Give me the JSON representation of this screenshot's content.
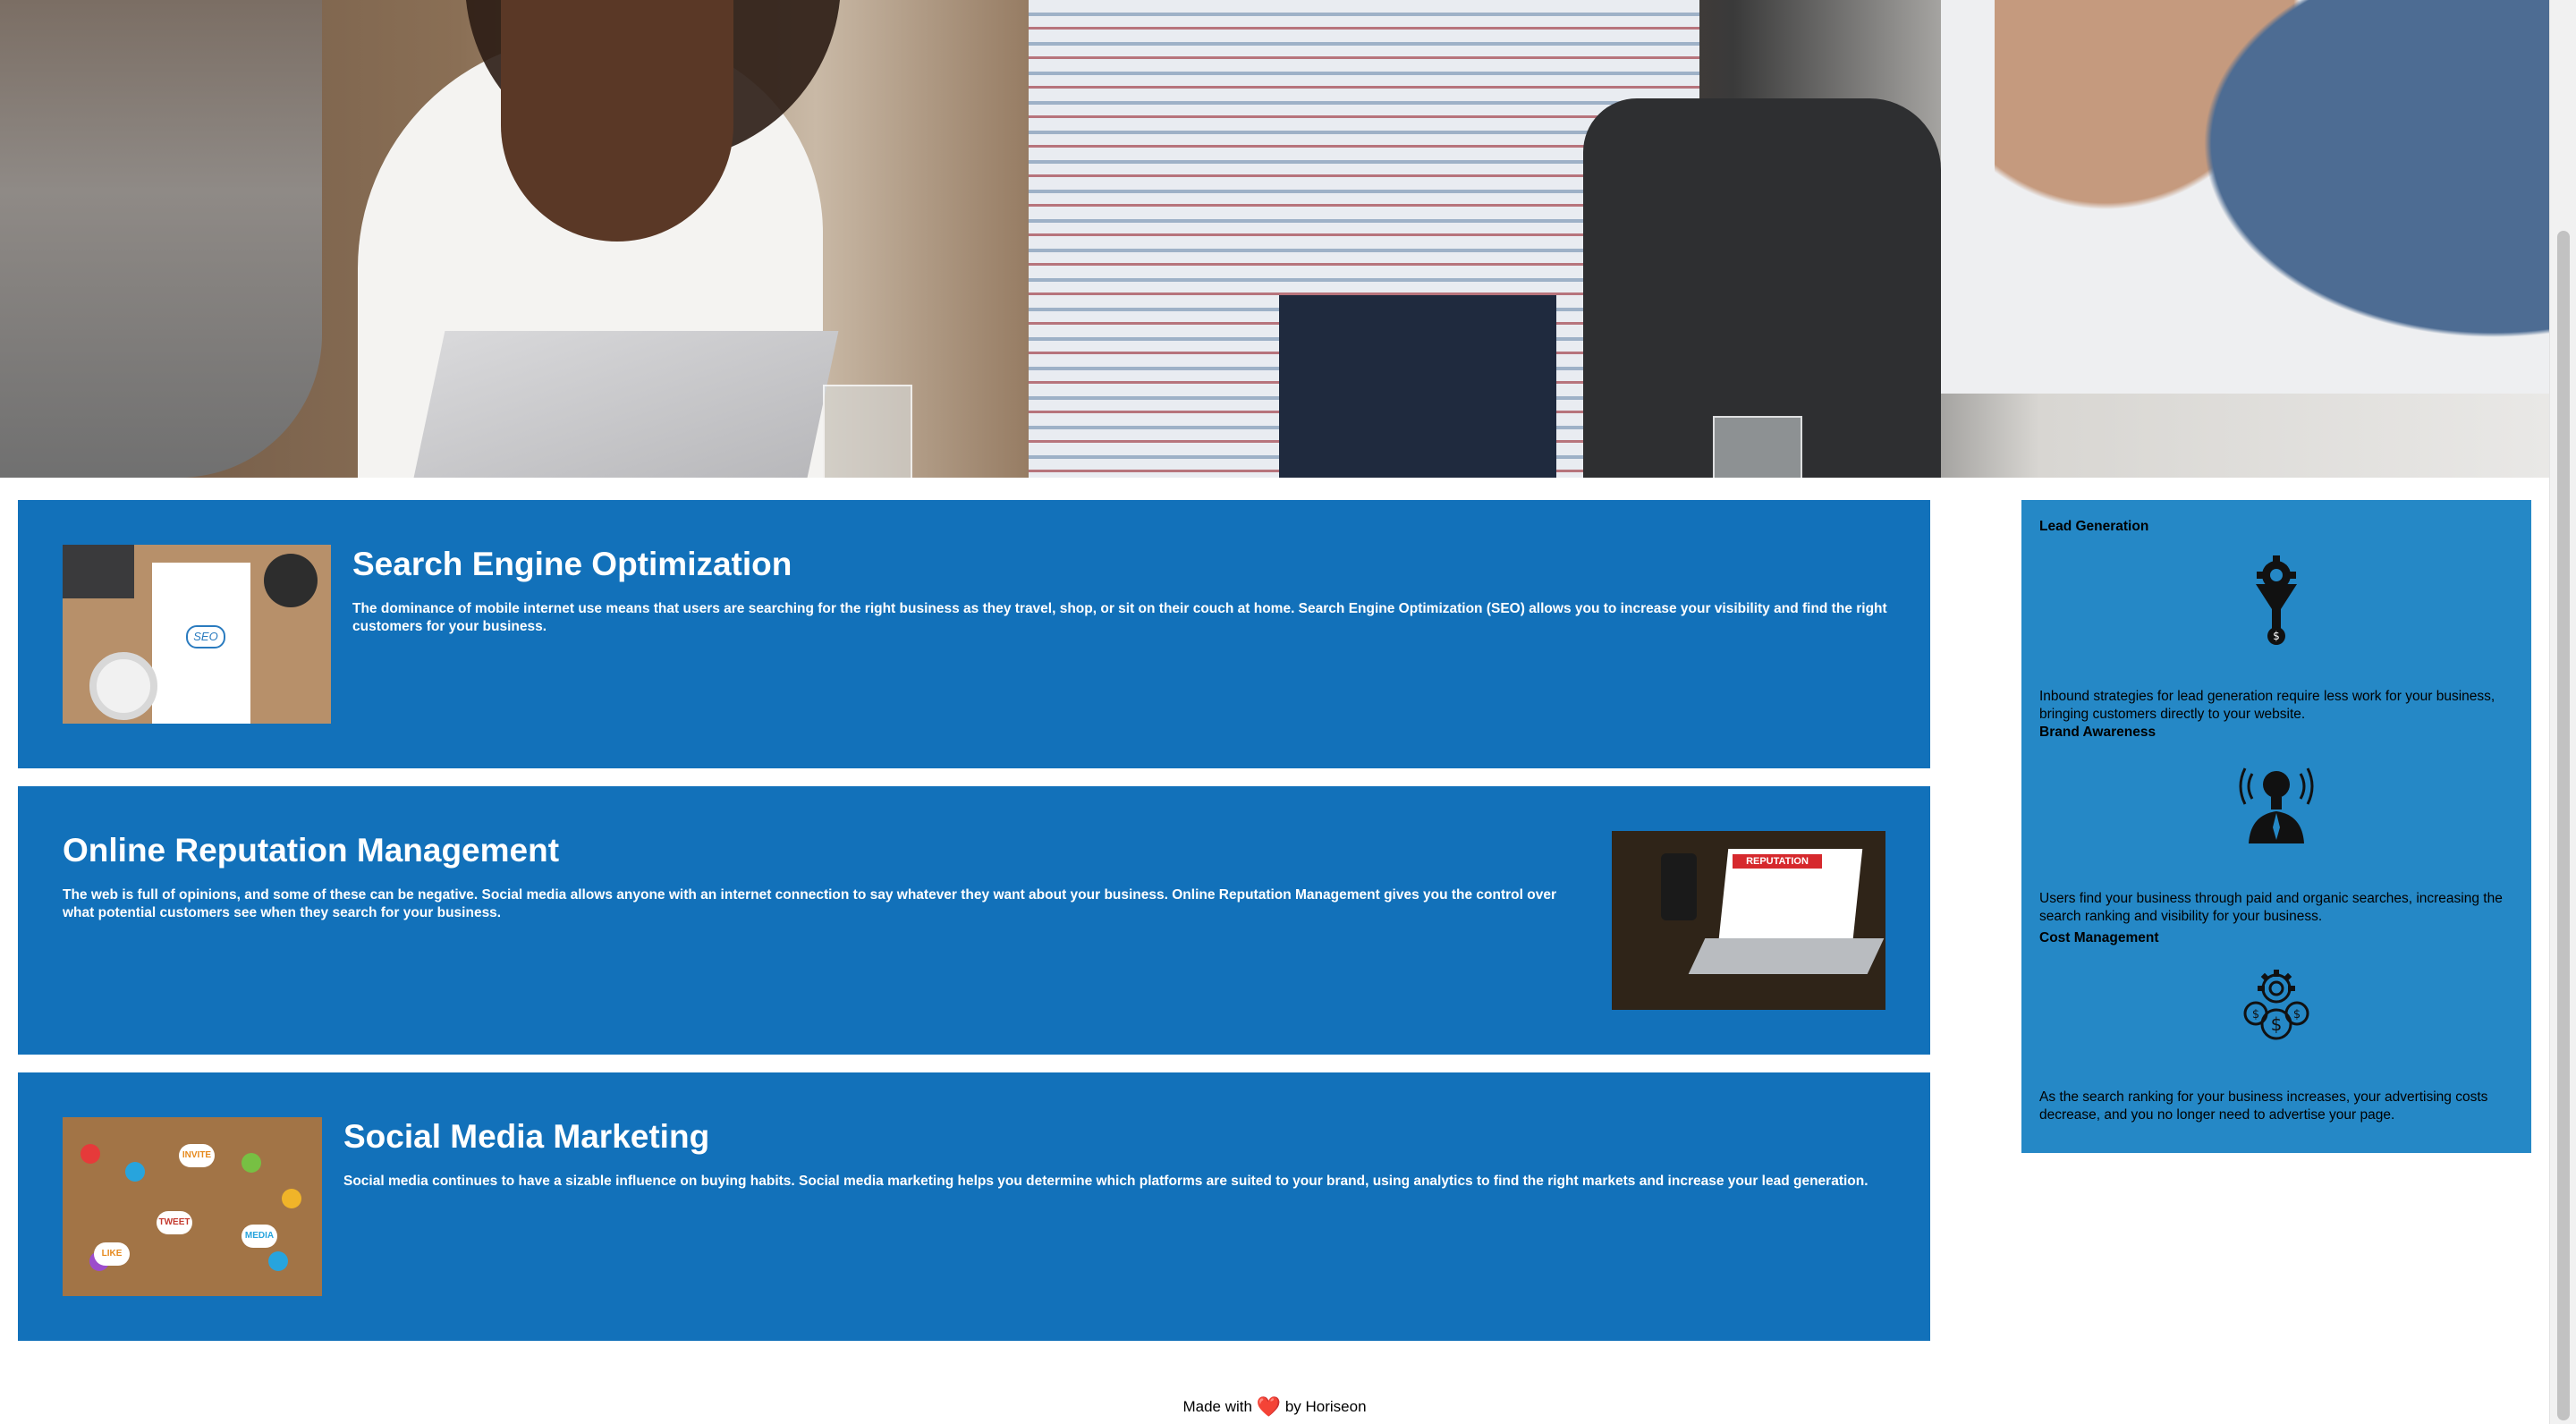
{
  "hero": {
    "image": "team-meeting-photo"
  },
  "sections": [
    {
      "id": "search-engine-optimization",
      "title": "Search Engine Optimization",
      "text": "The dominance of mobile internet use means that users are searching for the right business as they travel, shop, or sit on their couch at home. Search Engine Optimization (SEO) allows you to increase your visibility and find the right customers for your business.",
      "image": "seo-desk-illustration",
      "image_text": "SEO"
    },
    {
      "id": "online-reputation-management",
      "title": "Online Reputation Management",
      "text": "The web is full of opinions, and some of these can be negative. Social media allows anyone with an internet connection to say whatever they want about your business. Online Reputation Management gives you the control over what potential customers see when they search for your business.",
      "image": "reputation-laptop-photo",
      "image_text": "REPUTATION"
    },
    {
      "id": "social-media-marketing",
      "title": "Social Media Marketing",
      "text": "Social media continues to have a sizable influence on buying habits. Social media marketing helps you determine which platforms are suited to your brand, using analytics to find the right markets and increase your lead generation.",
      "image": "social-media-collage",
      "image_words": [
        "TWEET",
        "LIKE",
        "MEDIA",
        "INVITE"
      ]
    }
  ],
  "benefits": [
    {
      "id": "lead-generation",
      "title": "Lead Generation",
      "icon": "funnel-dollar-icon",
      "text": "Inbound strategies for lead generation require less work for your business, bringing customers directly to your website."
    },
    {
      "id": "brand-awareness",
      "title": "Brand Awareness",
      "icon": "lightbulb-person-icon",
      "text": "Users find your business through paid and organic searches, increasing the search ranking and visibility for your business."
    },
    {
      "id": "cost-management",
      "title": "Cost Management",
      "icon": "gear-coins-icon",
      "text": "As the search ranking for your business increases, your advertising costs decrease, and you no longer need to advertise your page."
    }
  ],
  "footer": {
    "prefix": "Made with",
    "heart": "❤️",
    "suffix": "by Horiseon"
  },
  "colors": {
    "section_bg": "#1271ba",
    "aside_bg": "#2588c6",
    "text_light": "#ffffff",
    "text_dark": "#000000"
  }
}
